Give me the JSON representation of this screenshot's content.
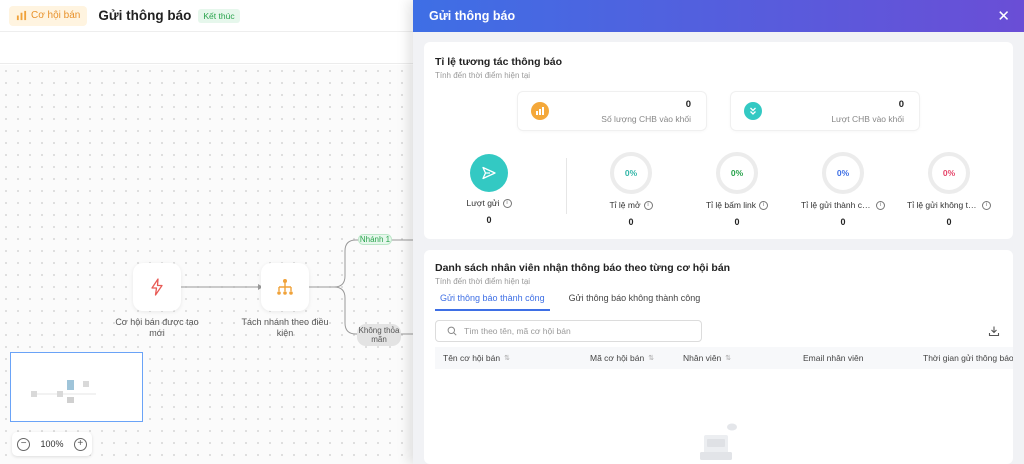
{
  "header": {
    "breadcrumb": "Cơ hội bán",
    "title": "Gửi thông báo",
    "status": "Kết thúc"
  },
  "flow": {
    "nodes": [
      {
        "label": "Cơ hội bán được tạo mới",
        "icon": "lightning-icon"
      },
      {
        "label": "Tách nhánh theo điều kiện",
        "icon": "branch-icon"
      }
    ],
    "branches": [
      "Nhánh 1",
      "Không thỏa mãn"
    ]
  },
  "zoom": {
    "level": "100%",
    "minus": "−",
    "plus": "+"
  },
  "drawer": {
    "title": "Gửi thông báo",
    "close": "✕",
    "stats": {
      "title": "Tỉ lệ tương tác thông báo",
      "subtitle": "Tính đến thời điểm hiện tại",
      "blocks": [
        {
          "value": "0",
          "label": "Số lượng CHB vào khối",
          "icon": "chart-icon",
          "color": "#f4a83a"
        },
        {
          "value": "0",
          "label": "Lượt CHB vào khối",
          "icon": "double-chevron-down-icon",
          "color": "#33c9c3"
        }
      ],
      "send": {
        "label": "Lượt gửi",
        "value": "0"
      },
      "metrics": [
        {
          "percent": "0%",
          "label": "Tỉ lệ mở",
          "value": "0",
          "color": "#33b6a8"
        },
        {
          "percent": "0%",
          "label": "Tỉ lệ bấm link",
          "value": "0",
          "color": "#29a34c"
        },
        {
          "percent": "0%",
          "label": "Tỉ lệ gửi thành công",
          "value": "0",
          "color": "#3e6fe5"
        },
        {
          "percent": "0%",
          "label": "Tỉ lệ gửi không thành công",
          "value": "0",
          "color": "#e5466a"
        }
      ]
    },
    "list": {
      "title": "Danh sách nhân viên nhận thông báo theo từng cơ hội bán",
      "subtitle": "Tính đến thời điểm hiện tại",
      "tabs": [
        "Gửi thông báo thành công",
        "Gửi thông báo không thành công"
      ],
      "search_placeholder": "Tìm theo tên, mã cơ hội bán",
      "columns": [
        "Tên cơ hội bán",
        "Mã cơ hội bán",
        "Nhân viên",
        "Email nhân viên",
        "Thời gian gửi thông báo"
      ]
    }
  }
}
